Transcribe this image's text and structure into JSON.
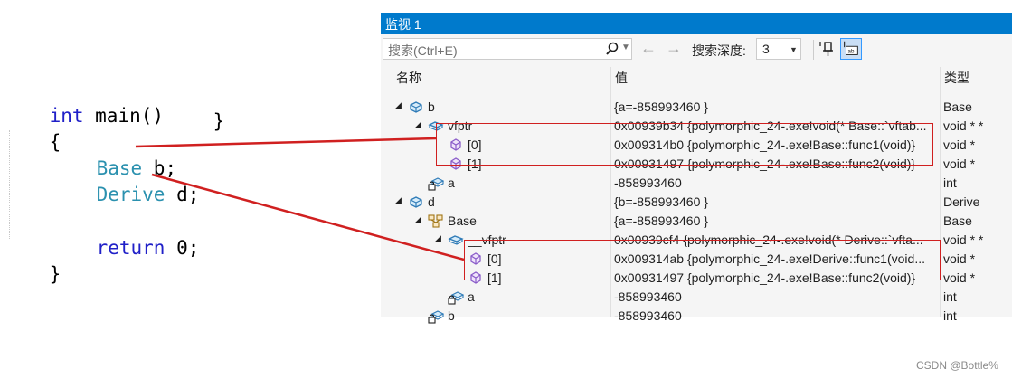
{
  "code": {
    "lines": [
      {
        "kw": "int",
        "rest": " main()"
      },
      {
        "kw": "",
        "rest": "{"
      },
      {
        "type": "Base",
        "rest": " b;"
      },
      {
        "type": "Derive",
        "rest": " d;"
      },
      {
        "kw": "return",
        "rest": " 0;"
      },
      {
        "kw": "",
        "rest": "}"
      }
    ],
    "stray_brace": "}"
  },
  "watch": {
    "title": "监视 1",
    "search_placeholder": "搜索(Ctrl+E)",
    "depth_label": "搜索深度:",
    "depth_value": "3",
    "columns": {
      "name": "名称",
      "value": "值",
      "type": "类型"
    },
    "rows": [
      {
        "name": "b",
        "value": "{a=-858993460 }",
        "type": "Base",
        "icon": "class-icon",
        "expander": "expanded"
      },
      {
        "name": "vfptr",
        "value": "0x00939b34 {polymorphic_24-.exe!void(* Base::`vftab...",
        "type": "void * *",
        "icon": "field-icon",
        "expander": "expanded"
      },
      {
        "name": "[0]",
        "value": "0x009314b0 {polymorphic_24-.exe!Base::func1(void)}",
        "type": "void *",
        "icon": "cube-icon",
        "expander": ""
      },
      {
        "name": "[1]",
        "value": "0x00931497 {polymorphic_24-.exe!Base::func2(void)}",
        "type": "void *",
        "icon": "cube-icon",
        "expander": ""
      },
      {
        "name": "a",
        "value": "-858993460",
        "type": "int",
        "icon": "private-field-icon",
        "expander": ""
      },
      {
        "name": "d",
        "value": "{b=-858993460 }",
        "type": "Derive",
        "icon": "class-icon",
        "expander": "expanded"
      },
      {
        "name": "Base",
        "value": "{a=-858993460 }",
        "type": "Base",
        "icon": "base-class-icon",
        "expander": "expanded"
      },
      {
        "name": "__vfptr",
        "value": "0x00939cf4 {polymorphic_24-.exe!void(* Derive::`vfta...",
        "type": "void * *",
        "icon": "field-icon",
        "expander": "expanded"
      },
      {
        "name": "[0]",
        "value": "0x009314ab {polymorphic_24-.exe!Derive::func1(void...",
        "type": "void *",
        "icon": "cube-icon",
        "expander": ""
      },
      {
        "name": "[1]",
        "value": "0x00931497 {polymorphic_24-.exe!Base::func2(void)}",
        "type": "void *",
        "icon": "cube-icon",
        "expander": ""
      },
      {
        "name": "a",
        "value": "-858993460",
        "type": "int",
        "icon": "private-field-icon",
        "expander": ""
      },
      {
        "name": "b",
        "value": "-858993460",
        "type": "int",
        "icon": "private-field-icon",
        "expander": ""
      }
    ]
  },
  "watermark": "CSDN @Bottle%",
  "colors": {
    "titlebar": "#007acc",
    "annotation": "#d02020",
    "keyword": "#2020c8",
    "type": "#2b91af"
  }
}
